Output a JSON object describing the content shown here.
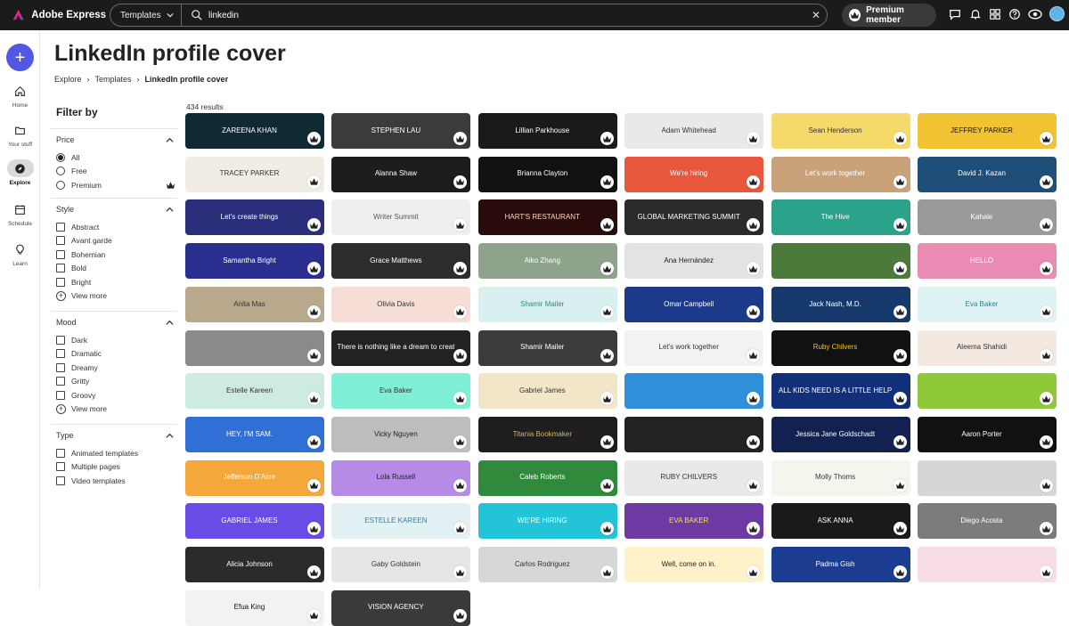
{
  "app": {
    "name": "Adobe Express",
    "brand_color": "#fa0f00"
  },
  "search": {
    "scope_label": "Templates",
    "query": "linkedin",
    "clear_icon": "close-icon"
  },
  "topbar": {
    "premium_label": "Premium member"
  },
  "rail": {
    "create_icon": "plus-icon",
    "items": [
      {
        "label": "Home",
        "icon": "home-icon"
      },
      {
        "label": "Your stuff",
        "icon": "folder-icon"
      },
      {
        "label": "Explore",
        "icon": "compass-icon",
        "active": true
      },
      {
        "label": "Schedule",
        "icon": "calendar-icon"
      },
      {
        "label": "Learn",
        "icon": "lightbulb-icon"
      }
    ]
  },
  "page": {
    "title": "LinkedIn profile cover",
    "breadcrumb": [
      "Explore",
      "Templates",
      "LinkedIn profile cover"
    ]
  },
  "filters": {
    "title": "Filter by",
    "price": {
      "label": "Price",
      "options": [
        "All",
        "Free",
        "Premium"
      ],
      "selected": "All"
    },
    "style": {
      "label": "Style",
      "options": [
        "Abstract",
        "Avant garde",
        "Bohemian",
        "Bold",
        "Bright"
      ],
      "more": "View more"
    },
    "mood": {
      "label": "Mood",
      "options": [
        "Dark",
        "Dramatic",
        "Dreamy",
        "Gritty",
        "Groovy"
      ],
      "more": "View more"
    },
    "type": {
      "label": "Type",
      "options": [
        "Animated templates",
        "Multiple pages",
        "Video templates"
      ]
    }
  },
  "results": {
    "count_label": "434 results",
    "cards": [
      {
        "text": "ZAREENA KHAN",
        "bg": "#0f2a33",
        "fg": "#ffffff"
      },
      {
        "text": "STEPHEN LAU",
        "bg": "#3b3b3b",
        "fg": "#ffffff"
      },
      {
        "text": "Lillian Parkhouse",
        "bg": "#1a1a1a",
        "fg": "#ffffff"
      },
      {
        "text": "Adam Whitehead",
        "bg": "#e9e9e9",
        "fg": "#333333"
      },
      {
        "text": "Sean Henderson",
        "bg": "#f6d96b",
        "fg": "#333333"
      },
      {
        "text": "JEFFREY PARKER",
        "bg": "#f1c232",
        "fg": "#111111"
      },
      {
        "text": "TRACEY PARKER",
        "bg": "#f2ede4",
        "fg": "#333333"
      },
      {
        "text": "Alanna Shaw",
        "bg": "#1d1d1d",
        "fg": "#ffffff"
      },
      {
        "text": "Brianna Clayton",
        "bg": "#111111",
        "fg": "#ffffff"
      },
      {
        "text": "We're hiring",
        "bg": "#e8573c",
        "fg": "#ffffff"
      },
      {
        "text": "Let's work together",
        "bg": "#c9a27a",
        "fg": "#ffffff"
      },
      {
        "text": "David J. Kazan",
        "bg": "#1f4e79",
        "fg": "#ffffff"
      },
      {
        "text": "Let's create things",
        "bg": "#2b2e7a",
        "fg": "#ffffff"
      },
      {
        "text": "Writer Summit",
        "bg": "#efefef",
        "fg": "#555555"
      },
      {
        "text": "HART'S RESTAURANT",
        "bg": "#2a0b0b",
        "fg": "#ffd3c0"
      },
      {
        "text": "GLOBAL MARKETING SUMMIT",
        "bg": "#2b2b2b",
        "fg": "#ffffff"
      },
      {
        "text": "The Hive",
        "bg": "#2aa38a",
        "fg": "#ffffff"
      },
      {
        "text": "Kahale",
        "bg": "#9a9a9a",
        "fg": "#ffffff"
      },
      {
        "text": "Samantha Bright",
        "bg": "#2a2f8f",
        "fg": "#ffffff"
      },
      {
        "text": "Grace Matthews",
        "bg": "#2d2d2d",
        "fg": "#ffffff"
      },
      {
        "text": "Aiko Zhang",
        "bg": "#8da38c",
        "fg": "#ffffff"
      },
      {
        "text": "Ana Hernández",
        "bg": "#e3e3e3",
        "fg": "#222222"
      },
      {
        "text": "",
        "bg": "#4c7a3a",
        "fg": "#ffffff"
      },
      {
        "text": "HELLO",
        "bg": "#e98bb3",
        "fg": "#ffffff"
      },
      {
        "text": "Anita Mas",
        "bg": "#b8a98c",
        "fg": "#333333"
      },
      {
        "text": "Olivia Davis",
        "bg": "#f6ddd5",
        "fg": "#333333"
      },
      {
        "text": "Shamir Mailer",
        "bg": "#d8f0f0",
        "fg": "#2e8b8b"
      },
      {
        "text": "Omar Campbell",
        "bg": "#1b3a8a",
        "fg": "#ffffff"
      },
      {
        "text": "Jack Nash, M.D.",
        "bg": "#16396b",
        "fg": "#ffffff"
      },
      {
        "text": "Eva Baker",
        "bg": "#dff3f4",
        "fg": "#2d7f8c"
      },
      {
        "text": "",
        "bg": "#8a8a8a",
        "fg": "#ffffff"
      },
      {
        "text": "There is nothing like a dream to create the future",
        "bg": "#222222",
        "fg": "#ffffff"
      },
      {
        "text": "Shamir Mailer",
        "bg": "#3c3c3c",
        "fg": "#ffffff"
      },
      {
        "text": "Let's work together",
        "bg": "#f2f2f2",
        "fg": "#333333"
      },
      {
        "text": "Ruby Chilvers",
        "bg": "#111111",
        "fg": "#f0c030"
      },
      {
        "text": "Aleema Shahidi",
        "bg": "#f4e9e1",
        "fg": "#333333"
      },
      {
        "text": "Estelle Kareen",
        "bg": "#cdebe3",
        "fg": "#333333"
      },
      {
        "text": "Eva Baker",
        "bg": "#7ff0d6",
        "fg": "#333333"
      },
      {
        "text": "Gabriel James",
        "bg": "#f2e6c8",
        "fg": "#333333"
      },
      {
        "text": "",
        "bg": "#2f8fd9",
        "fg": "#ffffff"
      },
      {
        "text": "ALL KIDS NEED IS A LITTLE HELP",
        "bg": "#12307a",
        "fg": "#ffffff"
      },
      {
        "text": "",
        "bg": "#8fc93a",
        "fg": "#ffffff"
      },
      {
        "text": "HEY, I'M SAM.",
        "bg": "#2f6fd6",
        "fg": "#ffffff"
      },
      {
        "text": "Vicky Nguyen",
        "bg": "#bdbdbd",
        "fg": "#222222"
      },
      {
        "text": "Titania Bookmaker",
        "bg": "#1e1e1e",
        "fg": "#d9b46a"
      },
      {
        "text": "",
        "bg": "#222222",
        "fg": "#ffffff"
      },
      {
        "text": "Jessica Jane Goldschadt",
        "bg": "#12214f",
        "fg": "#ffffff"
      },
      {
        "text": "Aaron Porter",
        "bg": "#111111",
        "fg": "#ffffff"
      },
      {
        "text": "Jefferson D'Acre",
        "bg": "#f4a83a",
        "fg": "#ffffff"
      },
      {
        "text": "Lola Russell",
        "bg": "#b58be6",
        "fg": "#222222"
      },
      {
        "text": "Caleb Roberts",
        "bg": "#2f8a3c",
        "fg": "#ffffff"
      },
      {
        "text": "RUBY CHILVERS",
        "bg": "#e9e9e9",
        "fg": "#333333"
      },
      {
        "text": "Molly Thoms",
        "bg": "#f5f5ee",
        "fg": "#333333"
      },
      {
        "text": "",
        "bg": "#d6d6d6",
        "fg": "#222222"
      },
      {
        "text": "GABRIEL JAMES",
        "bg": "#6b4be6",
        "fg": "#ffffff"
      },
      {
        "text": "ESTELLE KAREEN",
        "bg": "#e3f1f5",
        "fg": "#3a7ea0"
      },
      {
        "text": "WE'RE HIRING",
        "bg": "#23c4d8",
        "fg": "#ffffff"
      },
      {
        "text": "EVA BAKER",
        "bg": "#6d3aa3",
        "fg": "#f4e54a"
      },
      {
        "text": "ASK ANNA",
        "bg": "#1a1a1a",
        "fg": "#ffffff"
      },
      {
        "text": "Diego Acosta",
        "bg": "#7c7c7c",
        "fg": "#ffffff"
      },
      {
        "text": "Alicia Johnson",
        "bg": "#2b2b2b",
        "fg": "#ffffff"
      },
      {
        "text": "Gaby Goldstein",
        "bg": "#e6e6e6",
        "fg": "#333333"
      },
      {
        "text": "Carlos Rodriguez",
        "bg": "#d7d7d7",
        "fg": "#333333"
      },
      {
        "text": "Well, come on in.",
        "bg": "#fff1c9",
        "fg": "#222222"
      },
      {
        "text": "Padma Gish",
        "bg": "#1b3c91",
        "fg": "#ffffff"
      },
      {
        "text": "",
        "bg": "#f8dce6",
        "fg": "#222222"
      },
      {
        "text": "Efua King",
        "bg": "#f2f2f2",
        "fg": "#111111"
      },
      {
        "text": "VISION AGENCY",
        "bg": "#3a3a3a",
        "fg": "#ffffff"
      }
    ]
  }
}
